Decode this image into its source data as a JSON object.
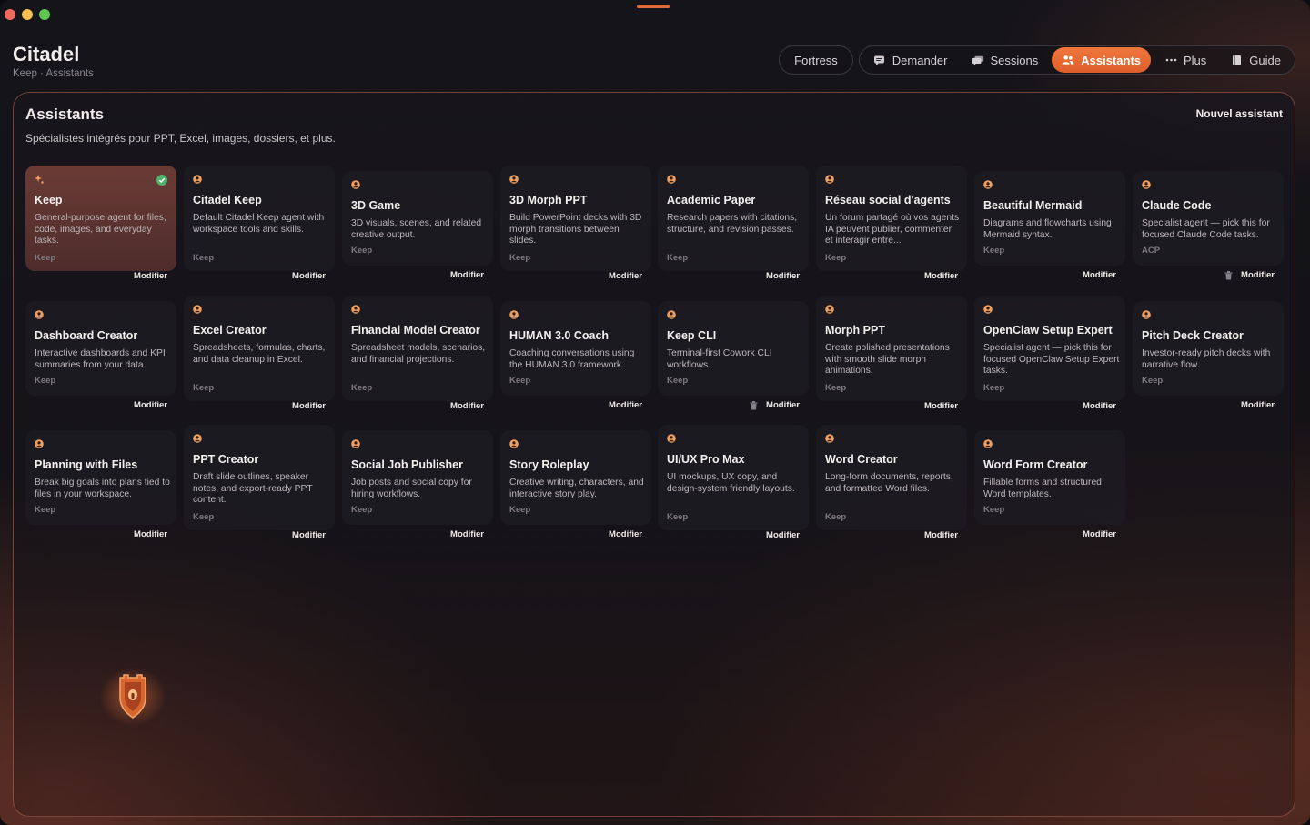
{
  "app": {
    "title": "Citadel",
    "breadcrumb": "Keep · Assistants"
  },
  "nav": {
    "fortress": "Fortress",
    "items": [
      {
        "label": "Demander",
        "icon": "chat-icon"
      },
      {
        "label": "Sessions",
        "icon": "sessions-icon"
      },
      {
        "label": "Assistants",
        "icon": "people-icon",
        "active": true
      },
      {
        "label": "Plus",
        "icon": "more-icon"
      },
      {
        "label": "Guide",
        "icon": "book-icon"
      }
    ]
  },
  "panel": {
    "title": "Assistants",
    "subtitle": "Spécialistes intégrés pour PPT, Excel, images, dossiers, et plus.",
    "new_button": "Nouvel assistant"
  },
  "edit_label": "Modifier",
  "cards": [
    {
      "name": "Keep",
      "desc": "General-purpose agent for files, code, images, and everyday tasks.",
      "tag": "Keep",
      "active": true,
      "icon": "sparkle-icon"
    },
    {
      "name": "Citadel Keep",
      "desc": "Default Citadel Keep agent with workspace tools and skills.",
      "tag": "Keep"
    },
    {
      "name": "3D Game",
      "desc": "3D visuals, scenes, and related creative output.",
      "tag": "Keep"
    },
    {
      "name": "3D Morph PPT",
      "desc": "Build PowerPoint decks with 3D morph transitions between slides.",
      "tag": "Keep"
    },
    {
      "name": "Academic Paper",
      "desc": "Research papers with citations, structure, and revision passes.",
      "tag": "Keep"
    },
    {
      "name": "Réseau social d'agents",
      "desc": "Un forum partagé où vos agents IA peuvent publier, commenter et interagir entre...",
      "tag": "Keep"
    },
    {
      "name": "Beautiful Mermaid",
      "desc": "Diagrams and flowcharts using Mermaid syntax.",
      "tag": "Keep"
    },
    {
      "name": "Claude Code",
      "desc": "Specialist agent — pick this for focused Claude Code tasks.",
      "tag": "ACP",
      "trash": true
    },
    {
      "name": "Dashboard Creator",
      "desc": "Interactive dashboards and KPI summaries from your data.",
      "tag": "Keep"
    },
    {
      "name": "Excel Creator",
      "desc": "Spreadsheets, formulas, charts, and data cleanup in Excel.",
      "tag": "Keep"
    },
    {
      "name": "Financial Model Creator",
      "desc": "Spreadsheet models, scenarios, and financial projections.",
      "tag": "Keep"
    },
    {
      "name": "HUMAN 3.0 Coach",
      "desc": "Coaching conversations using the HUMAN 3.0 framework.",
      "tag": "Keep"
    },
    {
      "name": "Keep CLI",
      "desc": "Terminal-first Cowork CLI workflows.",
      "tag": "Keep",
      "trash": true
    },
    {
      "name": "Morph PPT",
      "desc": "Create polished presentations with smooth slide morph animations.",
      "tag": "Keep"
    },
    {
      "name": "OpenClaw Setup Expert",
      "desc": "Specialist agent — pick this for focused OpenClaw Setup Expert tasks.",
      "tag": "Keep"
    },
    {
      "name": "Pitch Deck Creator",
      "desc": "Investor-ready pitch decks with narrative flow.",
      "tag": "Keep"
    },
    {
      "name": "Planning with Files",
      "desc": "Break big goals into plans tied to files in your workspace.",
      "tag": "Keep"
    },
    {
      "name": "PPT Creator",
      "desc": "Draft slide outlines, speaker notes, and export-ready PPT content.",
      "tag": "Keep"
    },
    {
      "name": "Social Job Publisher",
      "desc": "Job posts and social copy for hiring workflows.",
      "tag": "Keep"
    },
    {
      "name": "Story Roleplay",
      "desc": "Creative writing, characters, and interactive story play.",
      "tag": "Keep"
    },
    {
      "name": "UI/UX Pro Max",
      "desc": "UI mockups, UX copy, and design-system friendly layouts.",
      "tag": "Keep"
    },
    {
      "name": "Word Creator",
      "desc": "Long-form documents, reports, and formatted Word files.",
      "tag": "Keep"
    },
    {
      "name": "Word Form Creator",
      "desc": "Fillable forms and structured Word templates.",
      "tag": "Keep"
    }
  ],
  "colors": {
    "accent": "#f0773c",
    "panel_border": "#e6785a",
    "check": "#4fb26a"
  }
}
